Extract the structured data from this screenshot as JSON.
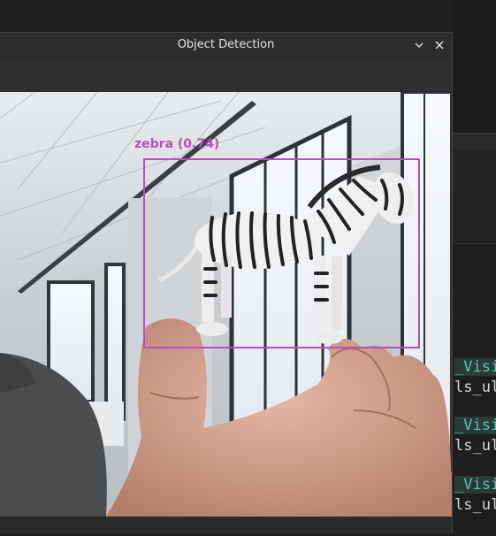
{
  "window": {
    "title": "Object Detection",
    "minimize_glyph": "⌄",
    "close_glyph": "✕"
  },
  "detection": {
    "label": "zebra",
    "confidence": "(0.74)",
    "box_color": "#b84fb8"
  },
  "background_code": {
    "lines": [
      {
        "highlight": "_Visi",
        "plain": ""
      },
      {
        "highlight": "",
        "plain": "ls_ul"
      },
      {
        "highlight": "_Visi",
        "plain": ""
      },
      {
        "highlight": "",
        "plain": "ls_ul"
      },
      {
        "highlight": "_Visi",
        "plain": ""
      },
      {
        "highlight": "",
        "plain": "ls_ul"
      }
    ]
  },
  "icons": {
    "minimize": "chevron-down-icon",
    "close": "close-icon"
  }
}
